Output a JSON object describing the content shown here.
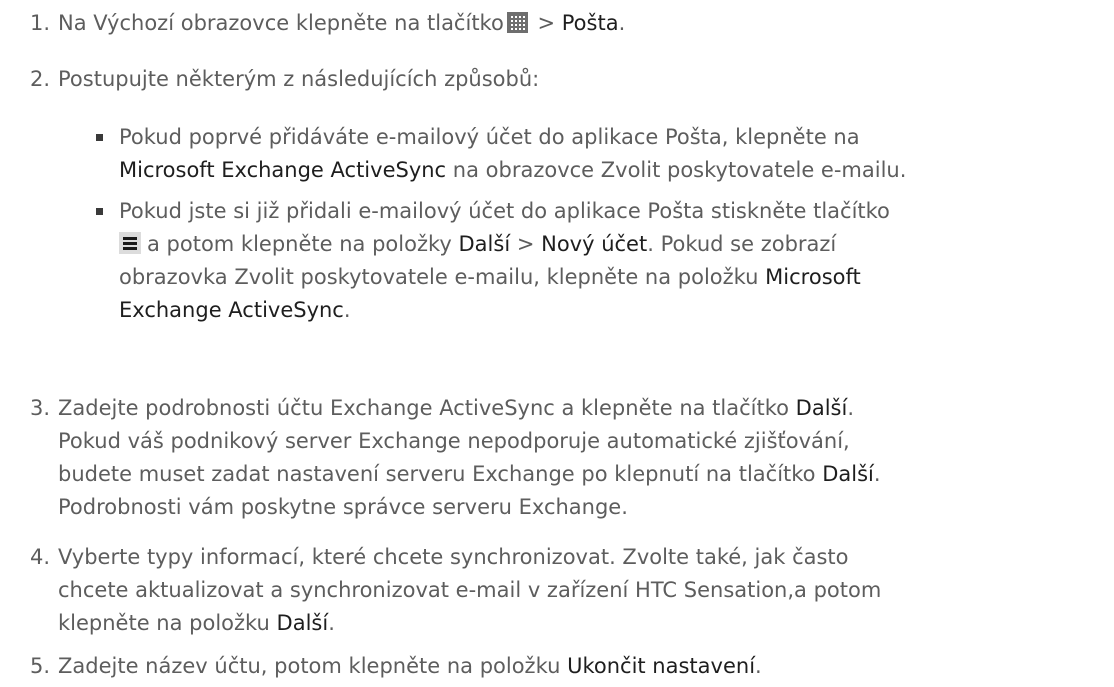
{
  "steps": [
    {
      "num": "1.",
      "p1": "Na Výchozí obrazovce klepněte na tlačítko",
      "icon": "apps-grid-icon",
      "p2": " > ",
      "b1": "Pošta",
      "p3": "."
    },
    {
      "num": "2.",
      "text": "Postupujte některým z následujících způsobů:"
    },
    {
      "num": "3.",
      "line1a": "Zadejte podrobnosti účtu Exchange ActiveSync a klepněte na tlačítko ",
      "line1b": "Další",
      "line1c": ".",
      "line2": "Pokud váš podnikový server Exchange nepodporuje automatické zjišťování,",
      "line3a": "budete muset zadat nastavení serveru Exchange po klepnutí na tlačítko ",
      "line3b": "Další",
      "line3c": ".",
      "line4": "Podrobnosti vám poskytne správce serveru Exchange."
    },
    {
      "num": "4.",
      "line1": "Vyberte typy informací, které chcete synchronizovat. Zvolte také, jak často",
      "line2": "chcete aktualizovat a synchronizovat e-mail v zařízení HTC Sensation,a potom",
      "line3a": "klepněte na položku ",
      "line3b": "Další",
      "line3c": "."
    },
    {
      "num": "5.",
      "p1": "Zadejte název účtu, potom klepněte na položku ",
      "b1": "Ukončit nastavení",
      "p2": "."
    }
  ],
  "bullets": [
    {
      "line1": "Pokud poprvé přidáváte e-mailový účet do aplikace Pošta, klepněte na",
      "line2a": "Microsoft Exchange ActiveSync",
      "line2b": " na obrazovce Zvolit poskytovatele e-mailu."
    },
    {
      "line1": "Pokud jste si již přidali e-mailový účet do aplikace Pošta stiskněte tlačítko",
      "icon": "menu-icon",
      "line2a": "a potom klepněte na položky ",
      "line2b": "Další",
      "line2c": " > ",
      "line2d": "Nový účet",
      "line2e": ". Pokud se zobrazí",
      "line3": "obrazovka Zvolit poskytovatele e-mailu, klepněte na položku ",
      "line3b": "Microsoft",
      "line4a": "Exchange ActiveSync",
      "line4b": "."
    }
  ]
}
